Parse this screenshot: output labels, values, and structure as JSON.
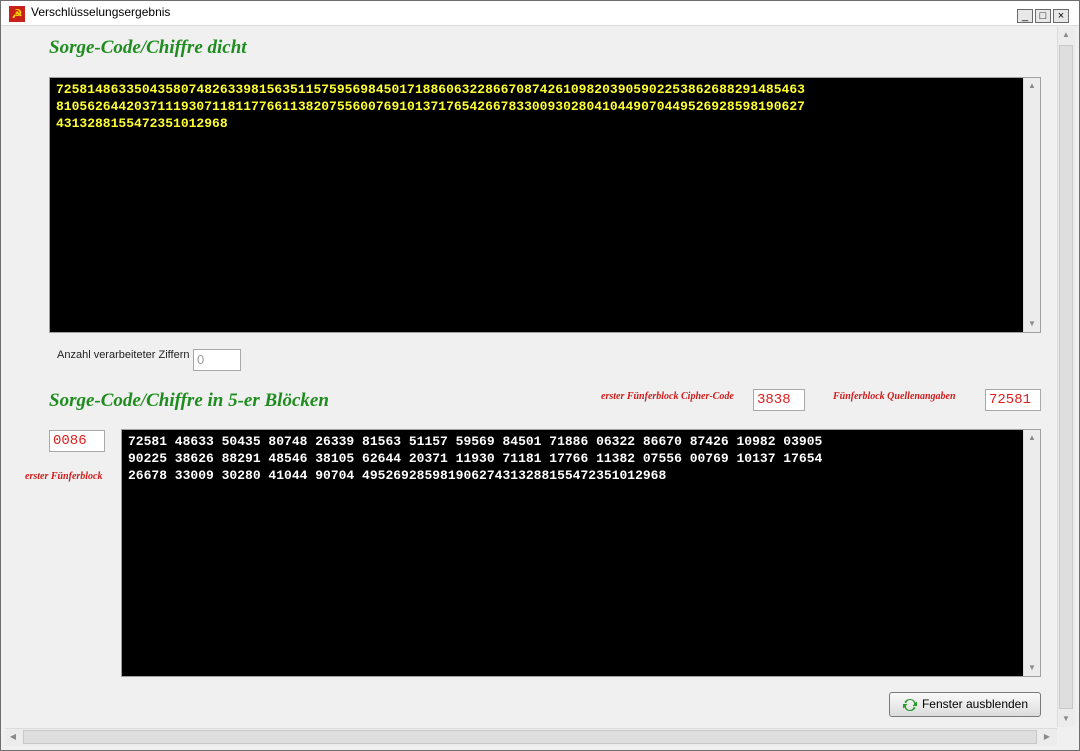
{
  "window": {
    "title": "Verschlüsselungsergebnis",
    "minimize_symbol": "_",
    "restore_symbol": "□",
    "close_symbol": "×"
  },
  "section1": {
    "heading": "Sorge-Code/Chiffre dicht",
    "lines": [
      "725814863350435807482633981563511575956984501718860632286670874261098203905902253862688291485463",
      "810562644203711193071181177661138207556007691013717654266783300930280410449070449526928598190627",
      "4313288155472351012968"
    ],
    "text_color": "#ffff32"
  },
  "count": {
    "label": "Anzahl verarbeiteter Ziffern",
    "value": "0"
  },
  "section2": {
    "heading": "Sorge-Code/Chiffre in 5-er Blöcken",
    "lines": [
      "72581 48633 50435 80748 26339 81563 51157 59569 84501 71886 06322 86670 87426 10982 03905",
      "90225 38626 88291 48546 38105 62644 20371 11930 71181 17766 11382 07556 00769 10137 17654",
      "26678 33009 30280 41044 90704 4952692859819062743132881554723510129​68"
    ],
    "text_color": "#ffffff"
  },
  "fields": {
    "cipher_label": "erster Fünferblock Cipher-Code",
    "cipher_value": "3838",
    "sources_label": "Fünferblock Quellenangaben",
    "sources_value": "72581",
    "first_block_label": "erster Fünferblock",
    "first_block_value": "0086"
  },
  "button": {
    "label": "Fenster ausblenden"
  },
  "colors": {
    "heading": "#1e8c1e",
    "accent_red": "#d01c1c",
    "memo_bg": "#000000"
  },
  "icons": {
    "app": "hammer-sickle-icon",
    "button": "refresh-icon"
  }
}
